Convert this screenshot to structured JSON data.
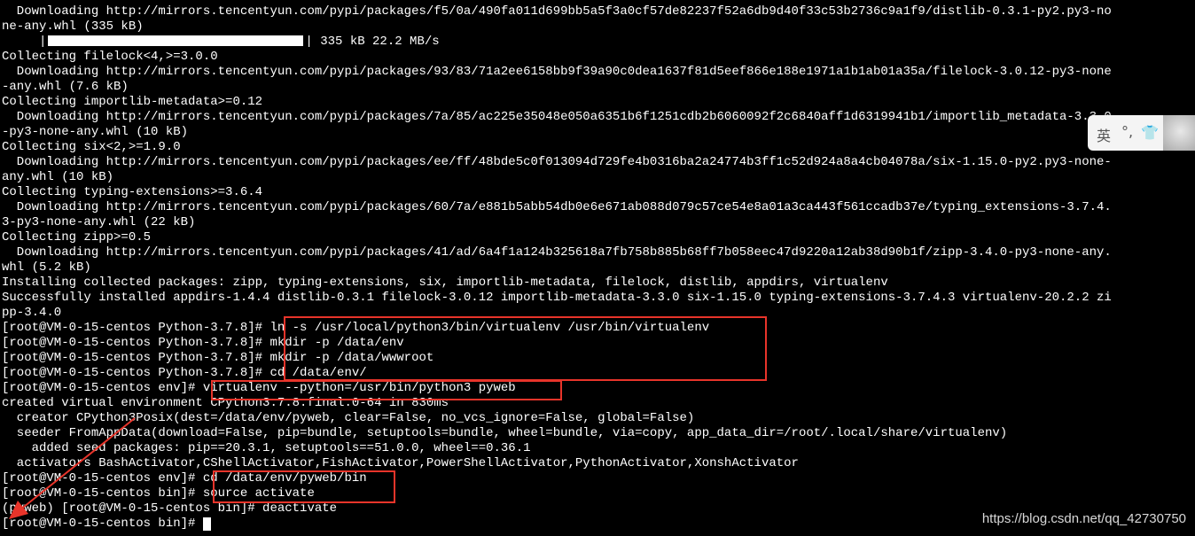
{
  "terminal": {
    "lines": [
      "  Downloading http://mirrors.tencentyun.com/pypi/packages/f5/0a/490fa011d699bb5a5f3a0cf57de82237f52a6db9d40f33c53b2736c9a1f9/distlib-0.3.1-py2.py3-no",
      "ne-any.whl (335 kB)",
      "",
      "Collecting filelock<4,>=3.0.0",
      "  Downloading http://mirrors.tencentyun.com/pypi/packages/93/83/71a2ee6158bb9f39a90c0dea1637f81d5eef866e188e1971a1b1ab01a35a/filelock-3.0.12-py3-none",
      "-any.whl (7.6 kB)",
      "Collecting importlib-metadata>=0.12",
      "  Downloading http://mirrors.tencentyun.com/pypi/packages/7a/85/ac225e35048e050a6351b6f1251cdb2b6060092f2c6840aff1d6319941b1/importlib_metadata-3.3.0",
      "-py3-none-any.whl (10 kB)",
      "Collecting six<2,>=1.9.0",
      "  Downloading http://mirrors.tencentyun.com/pypi/packages/ee/ff/48bde5c0f013094d729fe4b0316ba2a24774b3ff1c52d924a8a4cb04078a/six-1.15.0-py2.py3-none-",
      "any.whl (10 kB)",
      "Collecting typing-extensions>=3.6.4",
      "  Downloading http://mirrors.tencentyun.com/pypi/packages/60/7a/e881b5abb54db0e6e671ab088d079c57ce54e8a01a3ca443f561ccadb37e/typing_extensions-3.7.4.",
      "3-py3-none-any.whl (22 kB)",
      "Collecting zipp>=0.5",
      "  Downloading http://mirrors.tencentyun.com/pypi/packages/41/ad/6a4f1a124b325618a7fb758b885b68ff7b058eec47d9220a12ab38d90b1f/zipp-3.4.0-py3-none-any.",
      "whl (5.2 kB)",
      "Installing collected packages: zipp, typing-extensions, six, importlib-metadata, filelock, distlib, appdirs, virtualenv",
      "Successfully installed appdirs-1.4.4 distlib-0.3.1 filelock-3.0.12 importlib-metadata-3.3.0 six-1.15.0 typing-extensions-3.7.4.3 virtualenv-20.2.2 zi",
      "pp-3.4.0",
      "[root@VM-0-15-centos Python-3.7.8]# ln -s /usr/local/python3/bin/virtualenv /usr/bin/virtualenv",
      "[root@VM-0-15-centos Python-3.7.8]# mkdir -p /data/env",
      "[root@VM-0-15-centos Python-3.7.8]# mkdir -p /data/wwwroot",
      "[root@VM-0-15-centos Python-3.7.8]# cd /data/env/",
      "[root@VM-0-15-centos env]# virtualenv --python=/usr/bin/python3 pyweb",
      "created virtual environment CPython3.7.8.final.0-64 in 830ms",
      "  creator CPython3Posix(dest=/data/env/pyweb, clear=False, no_vcs_ignore=False, global=False)",
      "  seeder FromAppData(download=False, pip=bundle, setuptools=bundle, wheel=bundle, via=copy, app_data_dir=/root/.local/share/virtualenv)",
      "    added seed packages: pip==20.3.1, setuptools==51.0.0, wheel==0.36.1",
      "  activators BashActivator,CShellActivator,FishActivator,PowerShellActivator,PythonActivator,XonshActivator",
      "[root@VM-0-15-centos env]# cd /data/env/pyweb/bin",
      "[root@VM-0-15-centos bin]# source activate",
      "(pyweb) [root@VM-0-15-centos bin]# deactivate",
      "[root@VM-0-15-centos bin]# "
    ],
    "progress": {
      "prefix": "     |",
      "suffix": "| 335 kB 22.2 MB/s",
      "fraction": 1.0
    }
  },
  "ime": {
    "lang": "英",
    "punct": "°,",
    "shirt": "👕"
  },
  "watermark": "https://blog.csdn.net/qq_42730750",
  "colors": {
    "background": "#000000",
    "text": "#ffffff",
    "highlight": "#e8342a"
  }
}
